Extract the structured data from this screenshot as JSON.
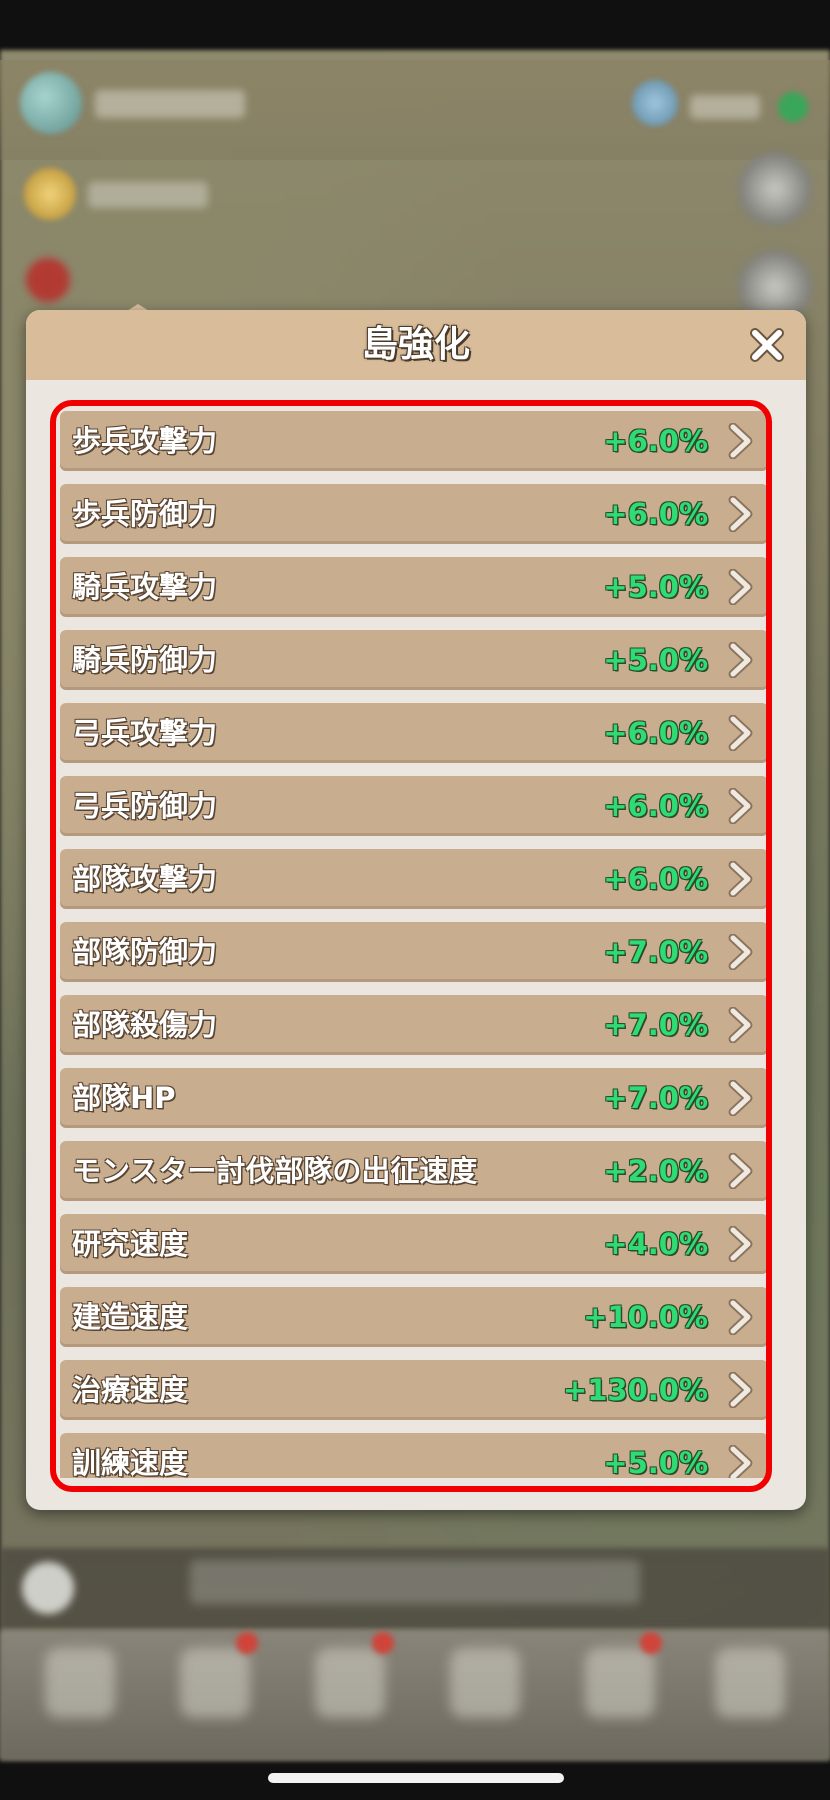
{
  "modal": {
    "title": "島強化",
    "close_icon": "close-x-icon"
  },
  "colors": {
    "value_green": "#2fdc74",
    "row_bg": "#c8ad8f",
    "header_bg": "#d9bd9a",
    "highlight_red": "#f00000"
  },
  "items": [
    {
      "label": "歩兵攻撃力",
      "value": "+6.0%"
    },
    {
      "label": "歩兵防御力",
      "value": "+6.0%"
    },
    {
      "label": "騎兵攻撃力",
      "value": "+5.0%"
    },
    {
      "label": "騎兵防御力",
      "value": "+5.0%"
    },
    {
      "label": "弓兵攻撃力",
      "value": "+6.0%"
    },
    {
      "label": "弓兵防御力",
      "value": "+6.0%"
    },
    {
      "label": "部隊攻撃力",
      "value": "+6.0%"
    },
    {
      "label": "部隊防御力",
      "value": "+7.0%"
    },
    {
      "label": "部隊殺傷力",
      "value": "+7.0%"
    },
    {
      "label": "部隊HP",
      "value": "+7.0%"
    },
    {
      "label": "モンスター討伐部隊の出征速度",
      "value": "+2.0%"
    },
    {
      "label": "研究速度",
      "value": "+4.0%"
    },
    {
      "label": "建造速度",
      "value": "+10.0%"
    },
    {
      "label": "治療速度",
      "value": "+130.0%"
    },
    {
      "label": "訓練速度",
      "value": "+5.0%"
    }
  ]
}
